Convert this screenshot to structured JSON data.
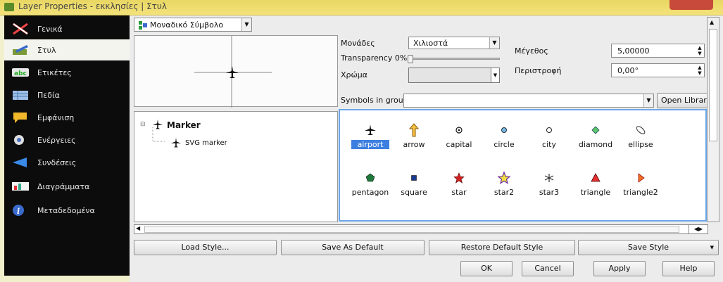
{
  "window": {
    "title": "Layer Properties - εκκλησίες | Στυλ"
  },
  "sidebar": {
    "items": [
      {
        "label": "Γενικά",
        "icon": "general-icon"
      },
      {
        "label": "Στυλ",
        "icon": "style-icon"
      },
      {
        "label": "Ετικέτες",
        "icon": "labels-icon"
      },
      {
        "label": "Πεδία",
        "icon": "fields-icon"
      },
      {
        "label": "Εμφάνιση",
        "icon": "display-icon"
      },
      {
        "label": "Ενέργειες",
        "icon": "actions-icon"
      },
      {
        "label": "Συνδέσεις",
        "icon": "joins-icon"
      },
      {
        "label": "Διαγράμματα",
        "icon": "diagrams-icon"
      },
      {
        "label": "Μεταδεδομένα",
        "icon": "metadata-icon"
      }
    ]
  },
  "renderer": {
    "value": "Μοναδικό Σύμβολο"
  },
  "props": {
    "units_label": "Μονάδες",
    "units_value": "Χιλιοστά",
    "transparency_label": "Transparency 0%",
    "color_label": "Χρώμα",
    "size_label": "Μέγεθος",
    "size_value": "5,00000",
    "rotation_label": "Περιστροφή",
    "rotation_value": "0,00°",
    "symbols_in_group_label": "Symbols in group",
    "open_library": "Open Librar"
  },
  "tree": {
    "root": "Marker",
    "child": "SVG marker"
  },
  "symbols": [
    {
      "name": "airport",
      "icon": "airport-icon",
      "selected": true
    },
    {
      "name": "arrow",
      "icon": "arrow-icon"
    },
    {
      "name": "capital",
      "icon": "capital-icon"
    },
    {
      "name": "circle",
      "icon": "circle-icon"
    },
    {
      "name": "city",
      "icon": "city-icon"
    },
    {
      "name": "diamond",
      "icon": "diamond-icon"
    },
    {
      "name": "ellipse",
      "icon": "ellipse-icon"
    },
    {
      "name": "pentagon",
      "icon": "pentagon-icon"
    },
    {
      "name": "square",
      "icon": "square-icon"
    },
    {
      "name": "star",
      "icon": "star-icon"
    },
    {
      "name": "star2",
      "icon": "star2-icon"
    },
    {
      "name": "star3",
      "icon": "star3-icon"
    },
    {
      "name": "triangle",
      "icon": "triangle-icon"
    },
    {
      "name": "triangle2",
      "icon": "triangle2-icon"
    }
  ],
  "buttons": {
    "load_style": "Load Style...",
    "save_default": "Save As Default",
    "restore_default": "Restore Default Style",
    "save_style": "Save Style",
    "ok": "OK",
    "cancel": "Cancel",
    "apply": "Apply",
    "help": "Help"
  },
  "colors": {
    "accent": "#3d7fe0",
    "sidebar_bg": "#0c0c0c",
    "title_bar": "#e9d763"
  }
}
